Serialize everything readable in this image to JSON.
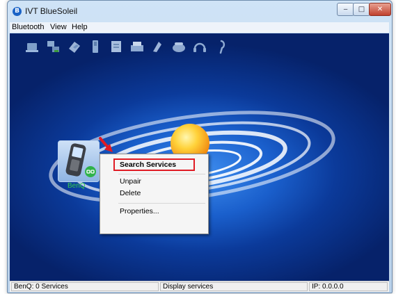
{
  "window": {
    "title": "IVT BlueSoleil",
    "controls": {
      "minimize": "‒",
      "maximize": "□",
      "close": "✕"
    }
  },
  "menubar": {
    "items": [
      "Bluetooth",
      "View",
      "Help"
    ]
  },
  "toolbar": {
    "service_icons": [
      "network-access-icon",
      "lan-access-icon",
      "file-transfer-icon",
      "serial-port-icon",
      "object-push-icon",
      "fax-icon",
      "pim-sync-icon",
      "dialup-networking-icon",
      "headset-icon",
      "hands-free-icon"
    ]
  },
  "device": {
    "name": "BenQ",
    "icon": "mobile-phone-icon",
    "status_icon": "paired-link-icon"
  },
  "context_menu": {
    "items": [
      "Search Services",
      "Unpair",
      "Delete",
      "Properties..."
    ],
    "highlighted": "Search Services",
    "highlight_color": "#e01b24"
  },
  "statusbar": {
    "device_info": "BenQ: 0 Services",
    "action": "Display services",
    "ip": "IP: 0.0.0.0"
  },
  "colors": {
    "background_accent": "#1a5fcc",
    "device_label": "#35d04a"
  }
}
